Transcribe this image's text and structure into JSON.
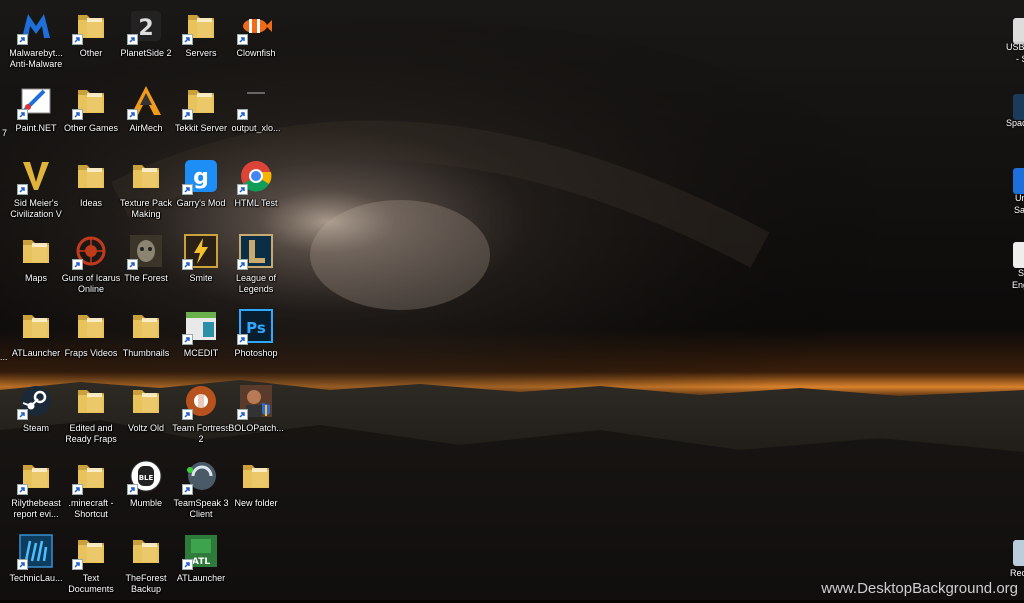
{
  "desktop": {
    "icons": [
      {
        "label": "Malwarebyt... Anti-Malware",
        "icon": "malwarebytes-icon"
      },
      {
        "label": "Other",
        "icon": "folder-icon"
      },
      {
        "label": "PlanetSide 2",
        "icon": "planetside-icon"
      },
      {
        "label": "Servers",
        "icon": "folder-icon"
      },
      {
        "label": "Clownfish",
        "icon": "clownfish-icon"
      },
      {
        "label": "Paint.NET",
        "icon": "paintnet-icon"
      },
      {
        "label": "Other Games",
        "icon": "folder-icon"
      },
      {
        "label": "AirMech",
        "icon": "airmech-icon"
      },
      {
        "label": "Tekkit Server",
        "icon": "folder-icon"
      },
      {
        "label": "output_xlo...",
        "icon": "blank-file-icon"
      },
      {
        "label": "Sid Meier's Civilization V",
        "icon": "civilization-icon"
      },
      {
        "label": "Ideas",
        "icon": "folder-icon"
      },
      {
        "label": "Texture Pack Making",
        "icon": "folder-icon"
      },
      {
        "label": "Garry's Mod",
        "icon": "garrysmod-icon"
      },
      {
        "label": "HTML Test",
        "icon": "chrome-icon"
      },
      {
        "label": "Maps",
        "icon": "folder-icon"
      },
      {
        "label": "Guns of Icarus Online",
        "icon": "guns-of-icarus-icon"
      },
      {
        "label": "The Forest",
        "icon": "the-forest-icon"
      },
      {
        "label": "Smite",
        "icon": "smite-icon"
      },
      {
        "label": "League of Legends",
        "icon": "league-of-legends-icon"
      },
      {
        "label": "ATLauncher",
        "icon": "folder-icon"
      },
      {
        "label": "Fraps Videos",
        "icon": "folder-icon"
      },
      {
        "label": "Thumbnails",
        "icon": "folder-icon"
      },
      {
        "label": "MCEDIT",
        "icon": "mcedit-icon"
      },
      {
        "label": "Photoshop",
        "icon": "photoshop-icon"
      },
      {
        "label": "Steam",
        "icon": "steam-icon"
      },
      {
        "label": "Edited and Ready Fraps",
        "icon": "folder-icon"
      },
      {
        "label": "Voltz Old",
        "icon": "folder-icon"
      },
      {
        "label": "Team Fortress 2",
        "icon": "team-fortress-icon"
      },
      {
        "label": "BOLOPatch...",
        "icon": "bolopatch-icon"
      },
      {
        "label": "Rilythebeast report evi...",
        "icon": "folder-icon"
      },
      {
        "label": ".minecraft - Shortcut",
        "icon": "folder-icon"
      },
      {
        "label": "Mumble",
        "icon": "mumble-icon"
      },
      {
        "label": "TeamSpeak 3 Client",
        "icon": "teamspeak-icon"
      },
      {
        "label": "New folder",
        "icon": "folder-icon"
      },
      {
        "label": "TechnicLau...",
        "icon": "technic-launcher-icon"
      },
      {
        "label": "Text Documents",
        "icon": "folder-icon"
      },
      {
        "label": "TheForest Backup",
        "icon": "folder-icon"
      },
      {
        "label": "ATLauncher",
        "icon": "atlauncher-icon"
      }
    ],
    "right_edge_labels": [
      "USB2",
      "- S",
      "Spac",
      "Un",
      "Sa",
      "S",
      "Eng",
      "Rec"
    ],
    "stray_marks": [
      "7",
      "..."
    ]
  },
  "watermark": "www.DesktopBackground.org",
  "colors": {
    "folder": "#e8c25a",
    "label_text": "#ffffff",
    "horizon_glow": "#d9822b"
  }
}
